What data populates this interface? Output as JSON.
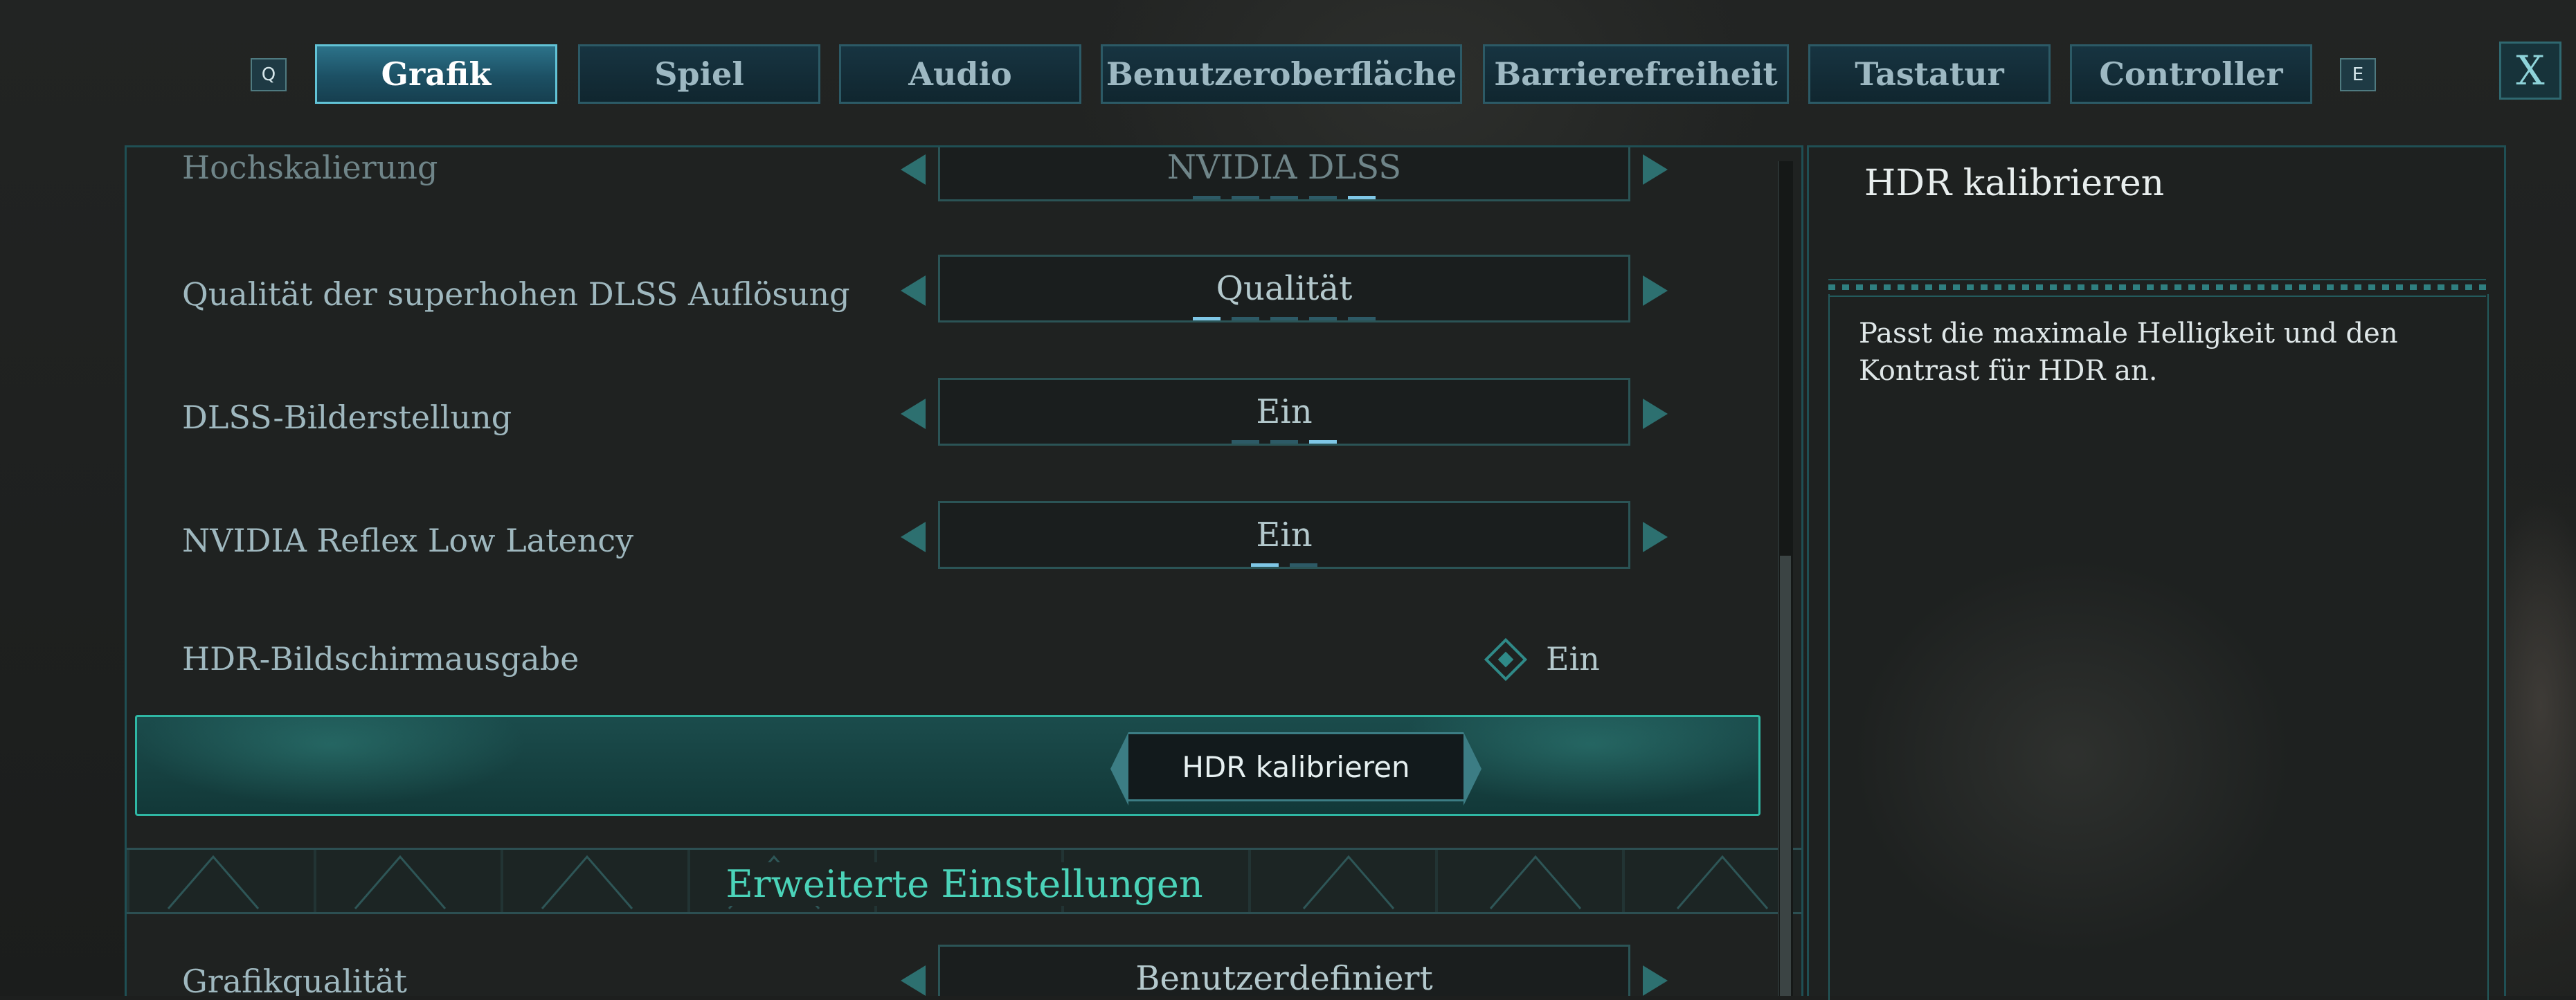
{
  "tabs": {
    "prev_key": "Q",
    "next_key": "E",
    "items": [
      {
        "label": "Grafik",
        "active": true
      },
      {
        "label": "Spiel",
        "active": false
      },
      {
        "label": "Audio",
        "active": false
      },
      {
        "label": "Benutzeroberfläche",
        "active": false
      },
      {
        "label": "Barrierefreiheit",
        "active": false
      },
      {
        "label": "Tastatur",
        "active": false
      },
      {
        "label": "Controller",
        "active": false
      }
    ],
    "close_label": "X"
  },
  "settings": {
    "rows": [
      {
        "label": "Hochskalierung",
        "value": "NVIDIA DLSS",
        "option_count": 5,
        "selected_index": 4
      },
      {
        "label": "Qualität der superhohen DLSS Auflösung",
        "value": "Qualität",
        "option_count": 5,
        "selected_index": 0
      },
      {
        "label": "DLSS-Bilderstellung",
        "value": "Ein",
        "option_count": 3,
        "selected_index": 2
      },
      {
        "label": "NVIDIA Reflex Low Latency",
        "value": "Ein",
        "option_count": 2,
        "selected_index": 0
      }
    ],
    "toggle_row": {
      "label": "HDR-Bildschirmausgabe",
      "value": "Ein"
    },
    "hdr_button_label": "HDR kalibrieren",
    "advanced_section_title": "Erweiterte Einstellungen",
    "advanced_rows": [
      {
        "label": "Grafikqualität",
        "value": "Benutzerdefiniert"
      }
    ]
  },
  "description": {
    "title": "HDR kalibrieren",
    "text": "Passt die maximale Helligkeit und den Kontrast für HDR an."
  },
  "colors": {
    "accent": "#4bd3b9",
    "active_tab": "#2c7289",
    "dot_on": "#7fc7e6",
    "dot_off": "#2d5a66"
  }
}
